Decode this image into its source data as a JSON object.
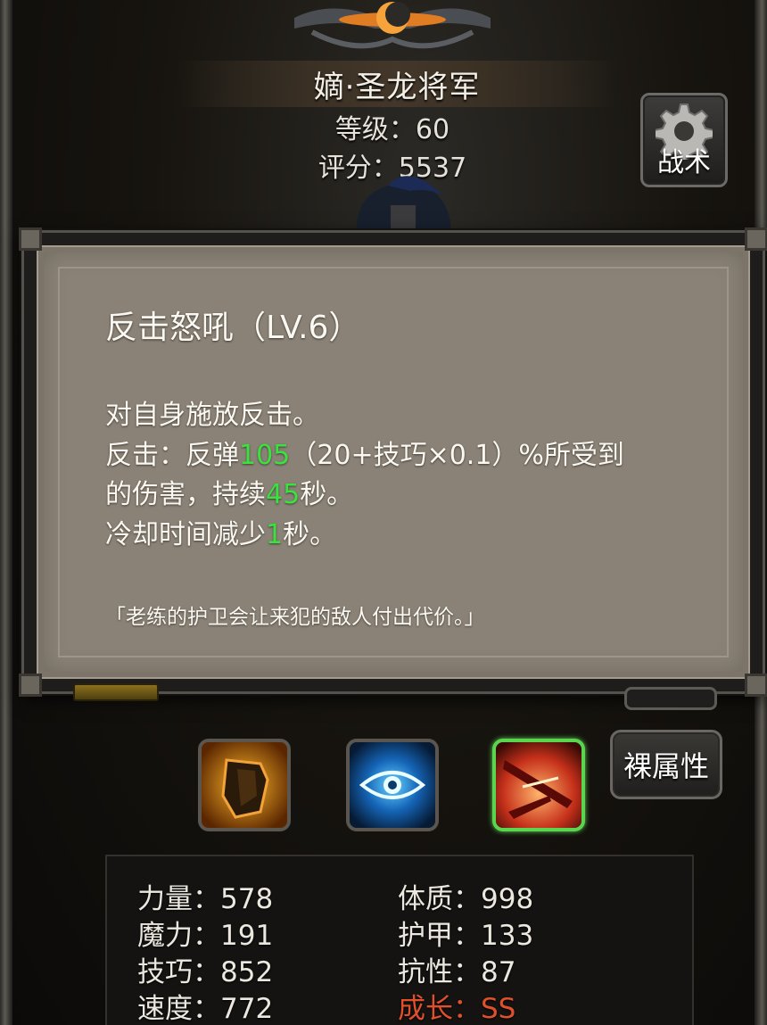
{
  "header": {
    "character_name": "嫡·圣龙将军",
    "level_text": "等级：60",
    "score_text": "评分：5537",
    "tactic_button_label": "战术"
  },
  "skill_popup": {
    "title": "反击怒吼（LV.6）",
    "line1": "对自身施放反击。",
    "line2_prefix": "反击：反弹",
    "line2_value": "105",
    "line2_suffix": "（20+技巧×0.1）%所受到",
    "line3_prefix": "的伤害，持续",
    "line3_value": "45",
    "line3_suffix": "秒。",
    "line4_prefix": "冷却时间减少",
    "line4_value": "1",
    "line4_suffix": "秒。",
    "quote": "「老练的护卫会让来犯的敌人付出代价。」"
  },
  "skills": [
    {
      "icon": "shield-icon",
      "selected": false
    },
    {
      "icon": "eye-icon",
      "selected": false
    },
    {
      "icon": "slash-icon",
      "selected": true
    }
  ],
  "naked_stats_button_label": "裸属性",
  "stats": {
    "strength": "力量：578",
    "magic": "魔力：191",
    "skill": "技巧：852",
    "speed": "速度：772",
    "constitution": "体质：998",
    "armor": "护甲：133",
    "resistance": "抗性：87",
    "growth": "成长：SS"
  },
  "colors": {
    "highlight_value": "#39e23d",
    "growth_text": "#e0502a",
    "selected_border": "#5bd54f",
    "popup_bg": "#8a8276"
  }
}
